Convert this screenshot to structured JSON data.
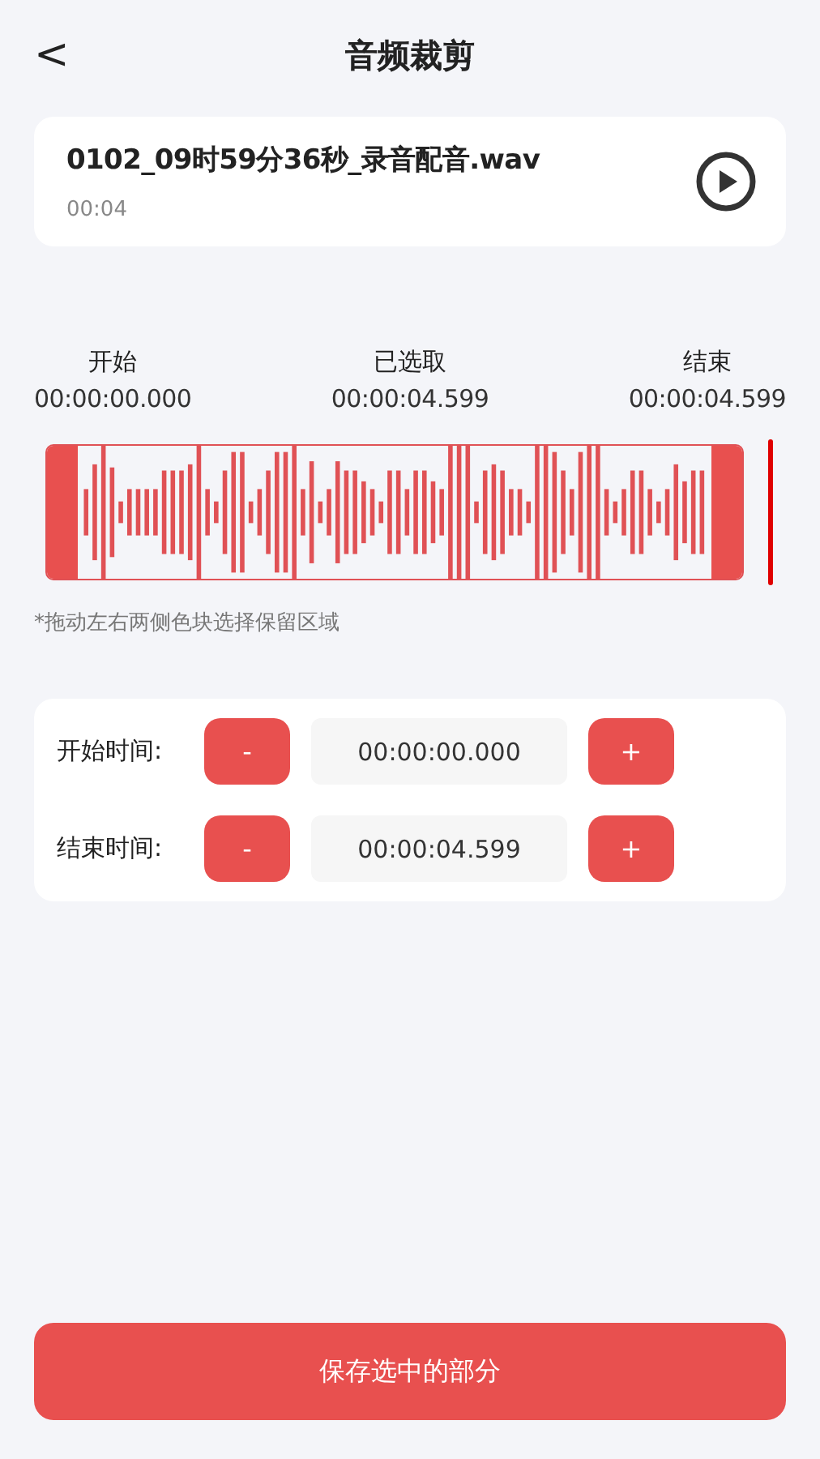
{
  "header": {
    "back": "<",
    "title": "音频裁剪"
  },
  "file": {
    "name": "0102_09时59分36秒_录音配音.wav",
    "duration": "00:04"
  },
  "times": [
    {
      "label": "开始",
      "value": "00:00:00.000"
    },
    {
      "label": "已选取",
      "value": "00:00:04.599"
    },
    {
      "label": "结束",
      "value": "00:00:04.599"
    }
  ],
  "hint": "*拖动左右两侧色块选择保留区域",
  "controls": [
    {
      "label": "开始时间:",
      "minus": "-",
      "value": "00:00:00.000",
      "plus": "+"
    },
    {
      "label": "结束时间:",
      "minus": "-",
      "value": "00:00:04.599",
      "plus": "+"
    }
  ],
  "save_button": "保存选中的部分"
}
